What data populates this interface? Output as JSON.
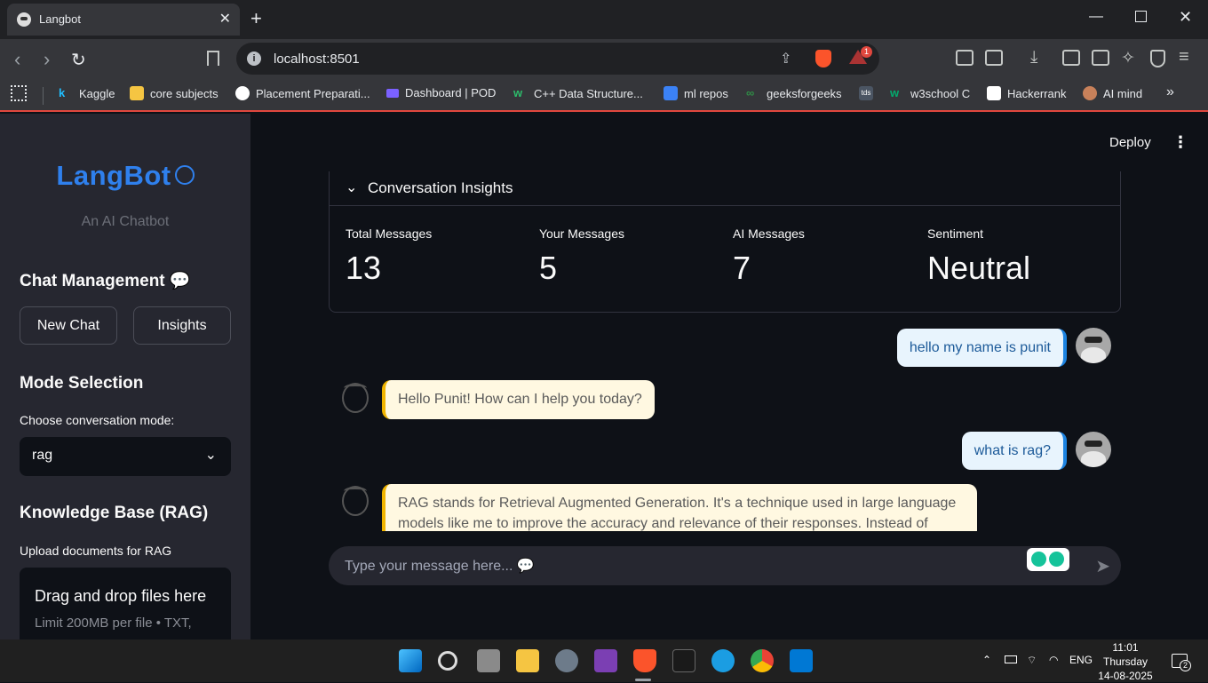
{
  "browser": {
    "tab_title": "Langbot",
    "tab_close": "✕",
    "new_tab": "+",
    "url": "localhost:8501",
    "notification_count": "1",
    "bookmarks": [
      {
        "label": "Kaggle",
        "icon": "kaggle-icon",
        "color": "#20beff"
      },
      {
        "label": "core subjects",
        "icon": "folder-icon",
        "color": "#f5c542"
      },
      {
        "label": "Placement Preparati...",
        "icon": "p-icon",
        "color": "#ffffff"
      },
      {
        "label": "Dashboard | POD",
        "icon": "pod-icon",
        "color": "#7b61ff"
      },
      {
        "label": "C++ Data Structure...",
        "icon": "w-icon",
        "color": "#2dbb6a"
      },
      {
        "label": "ml repos",
        "icon": "repo-icon",
        "color": "#3b82f6"
      },
      {
        "label": "geeksforgeeks",
        "icon": "gfg-icon",
        "color": "#2f8d46"
      },
      {
        "label": "tds",
        "icon": "tds-icon",
        "color": "#4b5563"
      },
      {
        "label": "w3school C",
        "icon": "w3-icon",
        "color": "#04aa6d"
      },
      {
        "label": "Hackerrank",
        "icon": "hackerrank-icon",
        "color": "#ffffff"
      },
      {
        "label": "AI mind",
        "icon": "ai-mind-icon",
        "color": "#c8815a"
      }
    ]
  },
  "sidebar": {
    "logo": "LangBot",
    "subtitle": "An AI Chatbot",
    "chat_management_title": "Chat Management 💬",
    "new_chat_label": "New Chat",
    "insights_label": "Insights",
    "mode_title": "Mode Selection",
    "mode_label": "Choose conversation mode:",
    "mode_value": "rag",
    "kb_title": "Knowledge Base (RAG)",
    "upload_label": "Upload documents for RAG",
    "drop_title": "Drag and drop files here",
    "drop_limit": "Limit 200MB per file • TXT,"
  },
  "header": {
    "deploy_label": "Deploy",
    "menu_icon": "⋮"
  },
  "insights": {
    "title": "Conversation Insights",
    "metrics": [
      {
        "label": "Total Messages",
        "value": "13"
      },
      {
        "label": "Your Messages",
        "value": "5"
      },
      {
        "label": "AI Messages",
        "value": "7"
      },
      {
        "label": "Sentiment",
        "value": "Neutral"
      }
    ]
  },
  "messages": [
    {
      "role": "user",
      "text": "hello my name is punit"
    },
    {
      "role": "assistant",
      "text": "Hello Punit! How can I help you today?"
    },
    {
      "role": "user",
      "text": "what is rag?"
    },
    {
      "role": "assistant",
      "text_line1": "RAG stands for Retrieval Augmented Generation. It's a technique used in large language",
      "text_line2": "models like me to improve the accuracy and relevance of their responses. Instead of relying"
    }
  ],
  "chat_input": {
    "placeholder": "Type your message here... 💬"
  },
  "taskbar": {
    "language": "ENG",
    "time": "11:01",
    "day": "Thursday",
    "date": "14-08-2025",
    "notification_count": "2"
  },
  "colors": {
    "accent": "#2f80ed",
    "app_bg": "#0e1117",
    "sidebar_bg": "#262730",
    "user_bubble": "#e8f4fd",
    "ai_bubble": "#fff8e1"
  }
}
